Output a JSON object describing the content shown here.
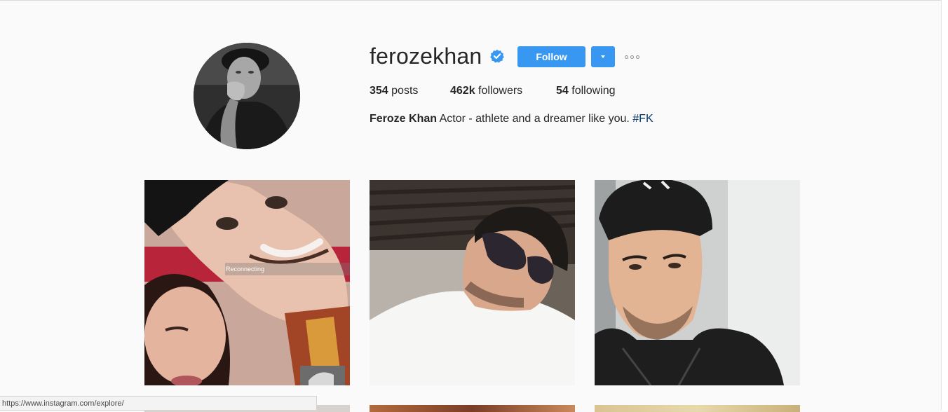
{
  "profile": {
    "username": "ferozekhan",
    "follow_label": "Follow",
    "stats": {
      "posts_count": "354",
      "posts_label": " posts",
      "followers_count": "462k",
      "followers_label": " followers",
      "following_count": "54",
      "following_label": " following"
    },
    "bio": {
      "name": "Feroze Khan",
      "text": " Actor - athlete and a dreamer like you. ",
      "hashtag": "#FK"
    }
  },
  "posts": [
    {
      "overlay_text": "Reconnecting"
    },
    {},
    {}
  ],
  "status_bar": {
    "url": "https://www.instagram.com/explore/"
  },
  "colors": {
    "accent": "#3897f0",
    "hashtag": "#003569",
    "background": "#fafafa"
  },
  "icons": {
    "verified": "verified-badge-icon",
    "dropdown": "caret-down-icon",
    "more": "more-options-icon"
  }
}
